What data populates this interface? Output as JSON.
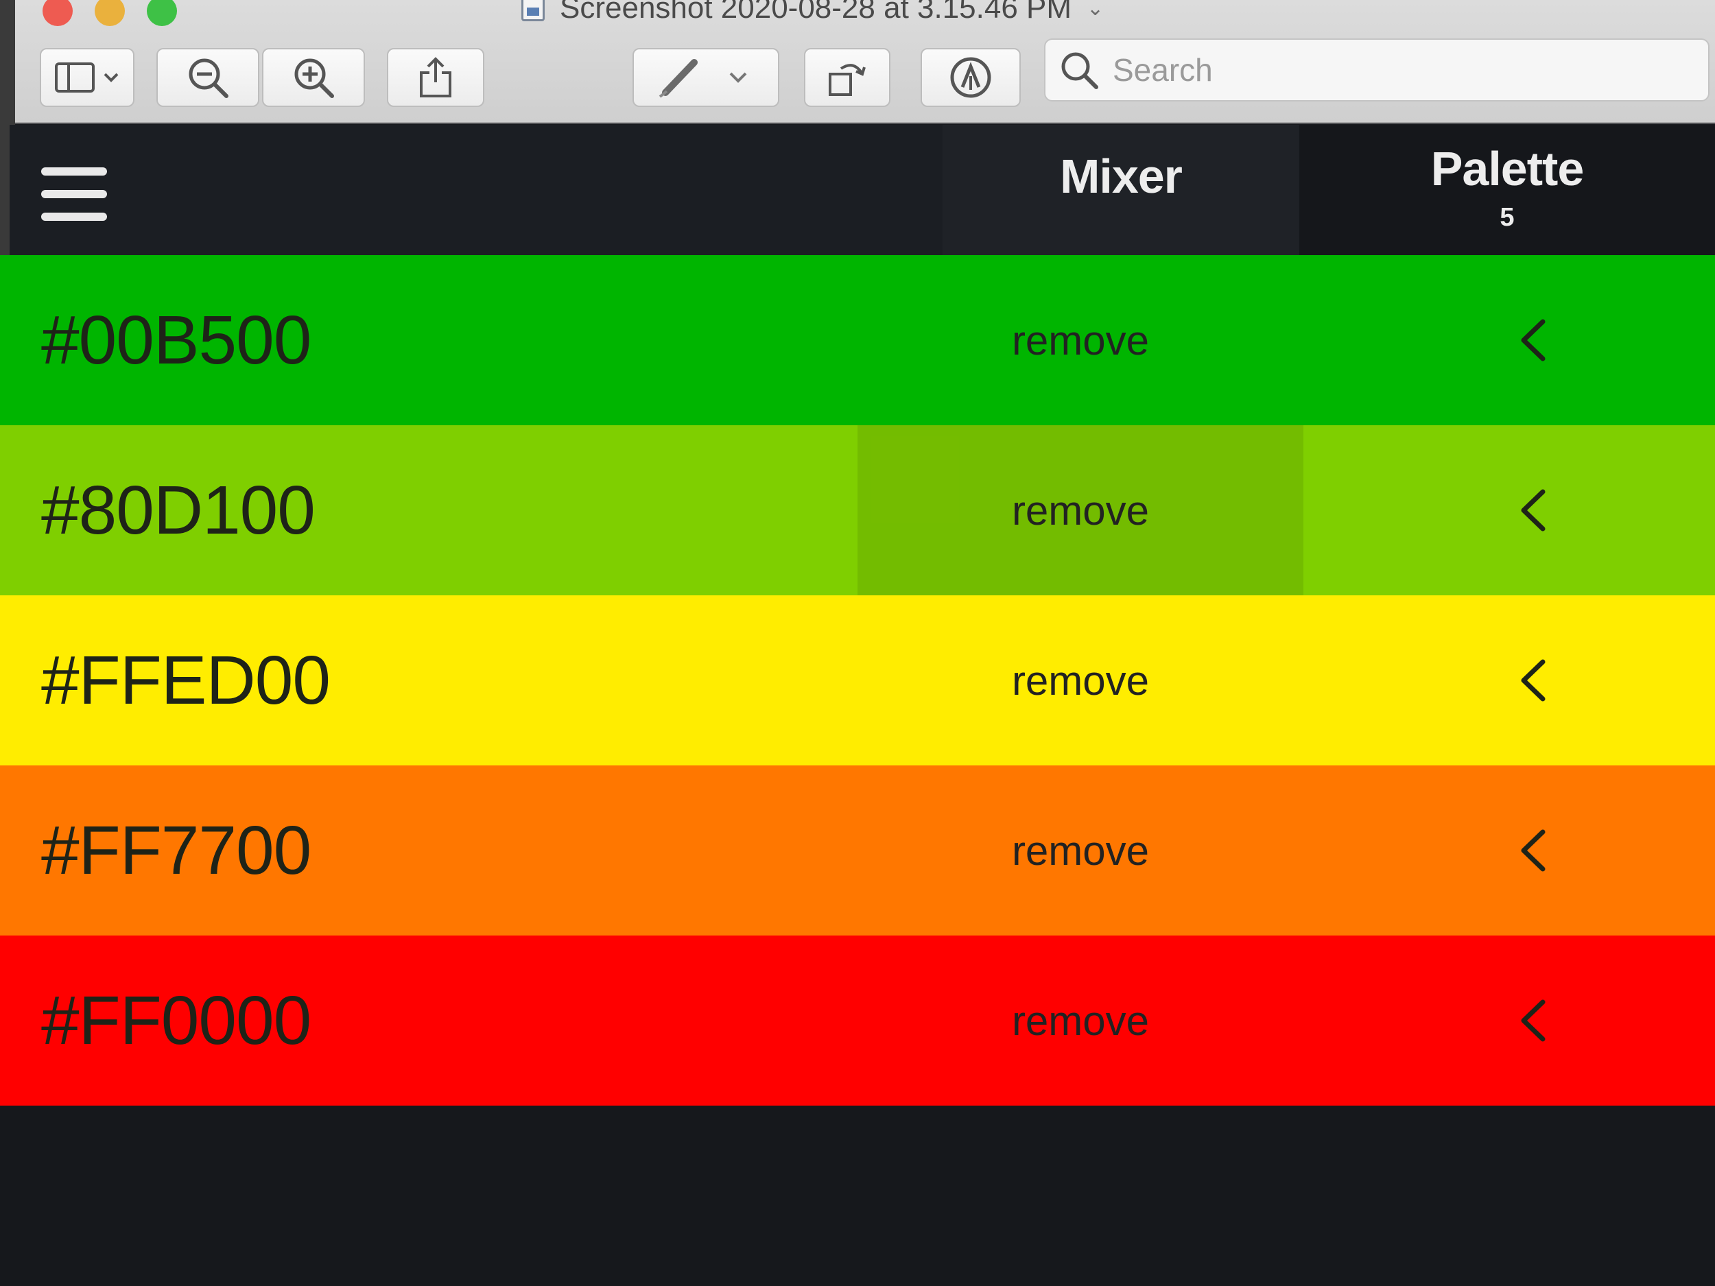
{
  "window": {
    "title": "Screenshot 2020-08-28 at 3.15.46 PM"
  },
  "toolbar": {
    "search_placeholder": "Search"
  },
  "app": {
    "tabs": [
      {
        "label": "Mixer"
      },
      {
        "label": "Palette",
        "count": "5"
      }
    ],
    "swatches": [
      {
        "hex": "#00B500",
        "color": "#00b500",
        "remove_label": "remove"
      },
      {
        "hex": "#80D100",
        "color": "#7fcf00",
        "remove_label": "remove"
      },
      {
        "hex": "#FFED00",
        "color": "#ffed00",
        "remove_label": "remove"
      },
      {
        "hex": "#FF7700",
        "color": "#ff7700",
        "remove_label": "remove"
      },
      {
        "hex": "#FF0000",
        "color": "#ff0000",
        "remove_label": "remove"
      }
    ]
  },
  "icons": {
    "sidebar_toggle": "sidebar-icon",
    "zoom_out": "zoom-out-icon",
    "zoom_in": "zoom-in-icon",
    "share": "share-icon",
    "markup": "pen-icon",
    "rotate": "rotate-icon",
    "annotate": "markup-circle-icon",
    "search": "search-icon",
    "menu": "hamburger-icon",
    "row_action": "chevron-left-icon"
  }
}
